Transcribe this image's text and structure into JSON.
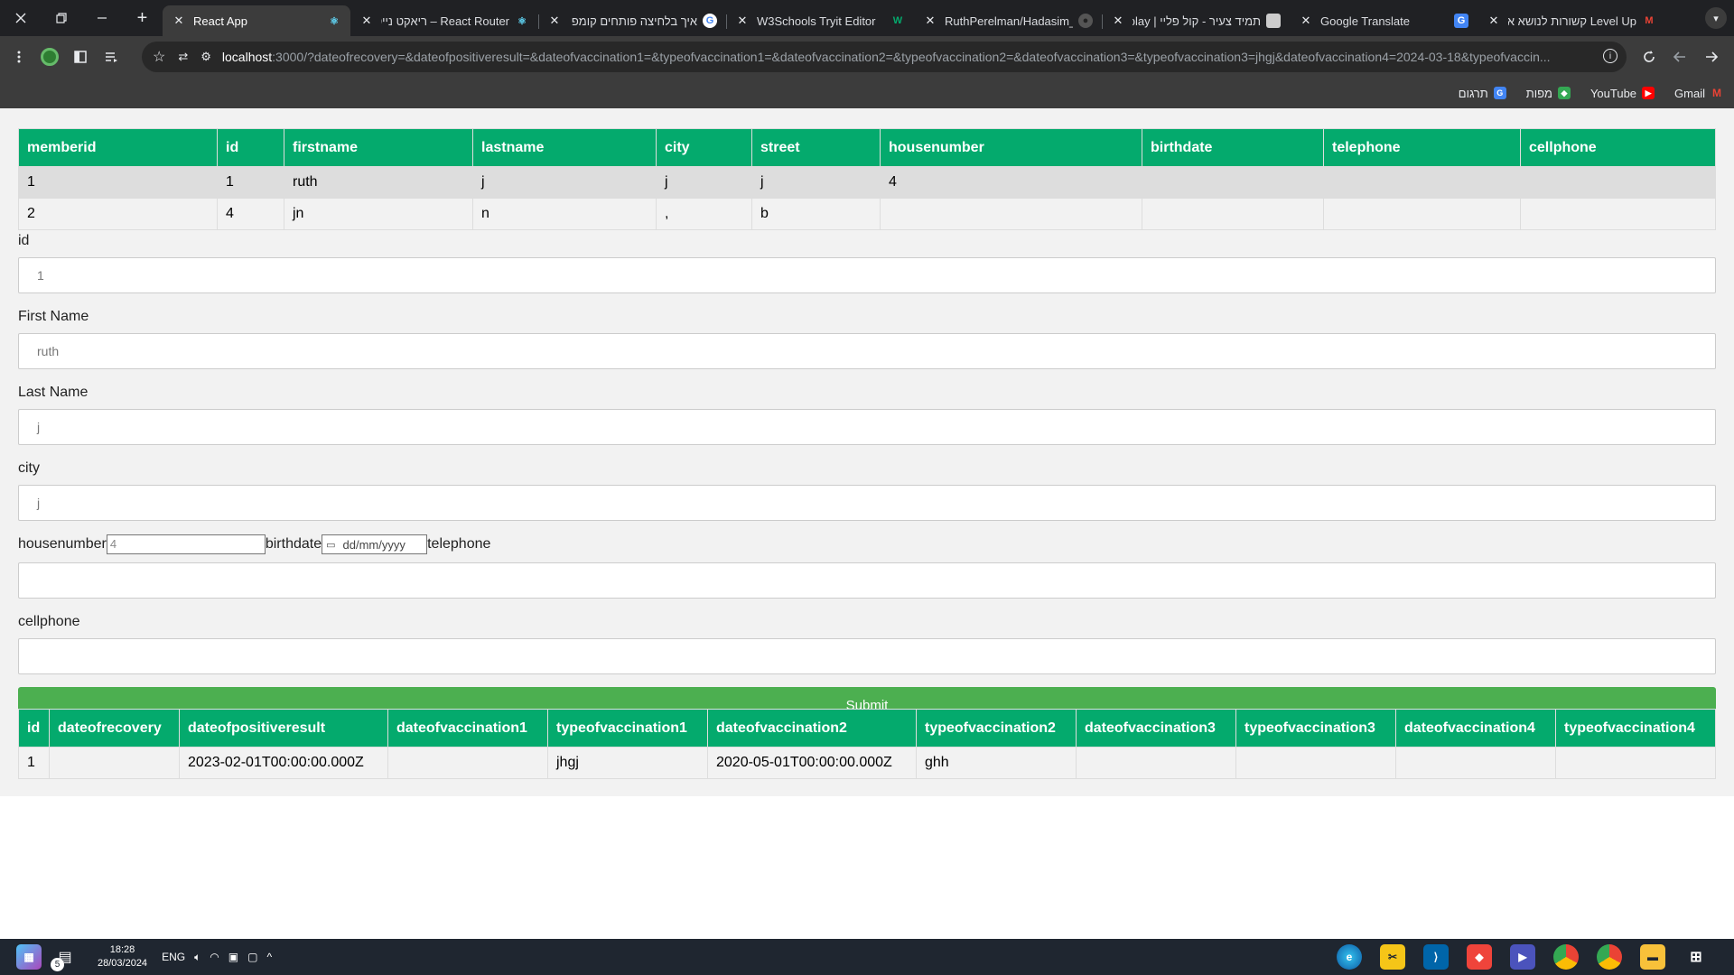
{
  "browser": {
    "tabs": [
      {
        "title": "React App",
        "active": true,
        "icon": "react-icon",
        "icon_color": "#61dafb"
      },
      {
        "title": "React Router – ריאקט נייטיב",
        "active": false,
        "icon": "react-icon",
        "icon_color": "#61dafb"
      },
      {
        "title": "איך בלחיצה פותחים קומפ",
        "active": false,
        "icon": "google-icon",
        "icon_color": "#ffffff"
      },
      {
        "title": "W3Schools Tryit Editor",
        "active": false,
        "icon": "w3schools-icon",
        "icon_color": "#04aa6d"
      },
      {
        "title": "RuthPerelman/Hadasim_h",
        "active": false,
        "icon": "github-icon",
        "icon_color": "#ffffff"
      },
      {
        "title": "תמיד צעיר - קול פליי | play",
        "active": false,
        "icon": "kolplay-icon",
        "icon_color": "#cccccc"
      },
      {
        "title": "Google Translate",
        "active": false,
        "icon": "translate-icon",
        "icon_color": "#4285f4"
      },
      {
        "title": "Level Up קשורות לנושא א",
        "active": false,
        "icon": "gmail-icon",
        "icon_color": "#ea4335"
      }
    ],
    "new_tab_symbol": "+",
    "url_host": "localhost",
    "url_rest": ":3000/?dateofrecovery=&dateofpositiveresult=&dateofvaccination1=&typeofvaccination1=&dateofvaccination2=&typeofvaccination2=&dateofvaccination3=&typeofvaccination3=jhgj&dateofvaccination4=2024-03-18&typeofvaccin...",
    "bookmarks": [
      {
        "label": "Gmail",
        "icon": "gmail-icon",
        "color": "#ea4335"
      },
      {
        "label": "YouTube",
        "icon": "youtube-icon",
        "color": "#ff0000"
      },
      {
        "label": "מפות",
        "icon": "maps-icon",
        "color": "#34a853"
      },
      {
        "label": "תרגום",
        "icon": "translate-icon",
        "color": "#4285f4"
      }
    ]
  },
  "members_table": {
    "headers": [
      "memberid",
      "id",
      "firstname",
      "lastname",
      "city",
      "street",
      "housenumber",
      "birthdate",
      "telephone",
      "cellphone"
    ],
    "rows": [
      [
        "1",
        "1",
        "ruth",
        "j",
        "j",
        "j",
        "4",
        "",
        "",
        ""
      ],
      [
        "2",
        "4",
        "jn",
        "n",
        ",",
        "b",
        "",
        "",
        "",
        ""
      ]
    ]
  },
  "form": {
    "id_label": "id",
    "id_value": "1",
    "firstname_label": "First Name",
    "firstname_value": "ruth",
    "lastname_label": "Last Name",
    "lastname_value": "j",
    "city_label": "city",
    "city_value": "j",
    "housenumber_label": "housenumber",
    "housenumber_value": "4",
    "birthdate_label": "birthdate",
    "birthdate_placeholder": "dd/mm/yyyy",
    "telephone_label": "telephone",
    "telephone_value": "",
    "cellphone_label": "cellphone",
    "cellphone_value": "",
    "submit_label": "Submit"
  },
  "vaccination_table": {
    "headers": [
      "id",
      "dateofrecovery",
      "dateofpositiveresult",
      "dateofvaccination1",
      "typeofvaccination1",
      "dateofvaccination2",
      "typeofvaccination2",
      "dateofvaccination3",
      "typeofvaccination3",
      "dateofvaccination4",
      "typeofvaccination4"
    ],
    "rows": [
      [
        "1",
        "",
        "2023-02-01T00:00:00.000Z",
        "",
        "jhgj",
        "2020-05-01T00:00:00.000Z",
        "ghh",
        "",
        "",
        "",
        ""
      ]
    ]
  },
  "taskbar": {
    "time": "18:28",
    "date": "28/03/2024",
    "language": "ENG",
    "notification_count": "5"
  },
  "colors": {
    "table_header": "#04aa6d",
    "submit_button": "#4caf50",
    "browser_dark": "#202124"
  }
}
